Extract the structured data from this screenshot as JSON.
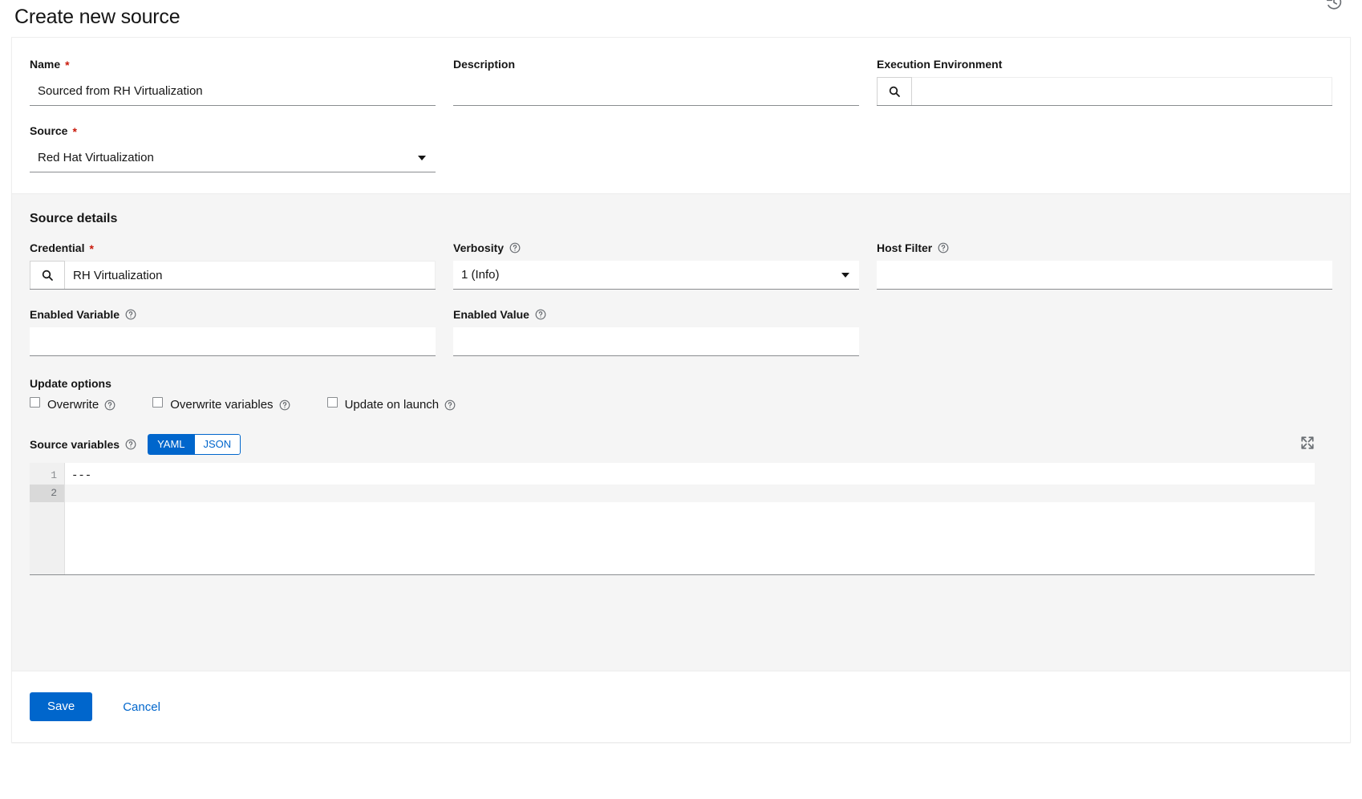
{
  "header": {
    "title": "Create new source",
    "history_icon": "history-icon"
  },
  "form": {
    "name": {
      "label": "Name",
      "required": "*",
      "value": "Sourced from RH Virtualization",
      "placeholder": ""
    },
    "description": {
      "label": "Description",
      "value": "",
      "placeholder": ""
    },
    "execution_environment": {
      "label": "Execution Environment",
      "value": "",
      "placeholder": "",
      "search_icon": "search-icon"
    },
    "source": {
      "label": "Source",
      "required": "*",
      "value": "Red Hat Virtualization",
      "options": [
        "Red Hat Virtualization"
      ]
    }
  },
  "details": {
    "heading": "Source details",
    "credential": {
      "label": "Credential",
      "required": "*",
      "value": "RH Virtualization",
      "placeholder": "",
      "search_icon": "search-icon"
    },
    "verbosity": {
      "label": "Verbosity",
      "value": "1 (Info)",
      "help_icon": "help-icon",
      "options": [
        "1 (Info)"
      ]
    },
    "host_filter": {
      "label": "Host Filter",
      "value": "",
      "placeholder": "",
      "help_icon": "help-icon"
    },
    "enabled_variable": {
      "label": "Enabled Variable",
      "value": "",
      "placeholder": "",
      "help_icon": "help-icon"
    },
    "enabled_value": {
      "label": "Enabled Value",
      "value": "",
      "placeholder": "",
      "help_icon": "help-icon"
    },
    "update_options": {
      "heading": "Update options",
      "items": [
        {
          "label": "Overwrite",
          "checked": false,
          "help_icon": "help-icon"
        },
        {
          "label": "Overwrite variables",
          "checked": false,
          "help_icon": "help-icon"
        },
        {
          "label": "Update on launch",
          "checked": false,
          "help_icon": "help-icon"
        }
      ]
    },
    "source_variables": {
      "label": "Source variables",
      "help_icon": "help-icon",
      "format_yaml": "YAML",
      "format_json": "JSON",
      "active_format": "YAML",
      "expand_icon": "expand-icon",
      "lines": [
        {
          "number": "1",
          "text": "---",
          "active": false
        },
        {
          "number": "2",
          "text": "",
          "active": true
        }
      ]
    }
  },
  "footer": {
    "save_label": "Save",
    "cancel_label": "Cancel"
  },
  "colors": {
    "accent": "#0066cc",
    "required": "#c9190b",
    "panel_bg": "#f5f5f5"
  }
}
